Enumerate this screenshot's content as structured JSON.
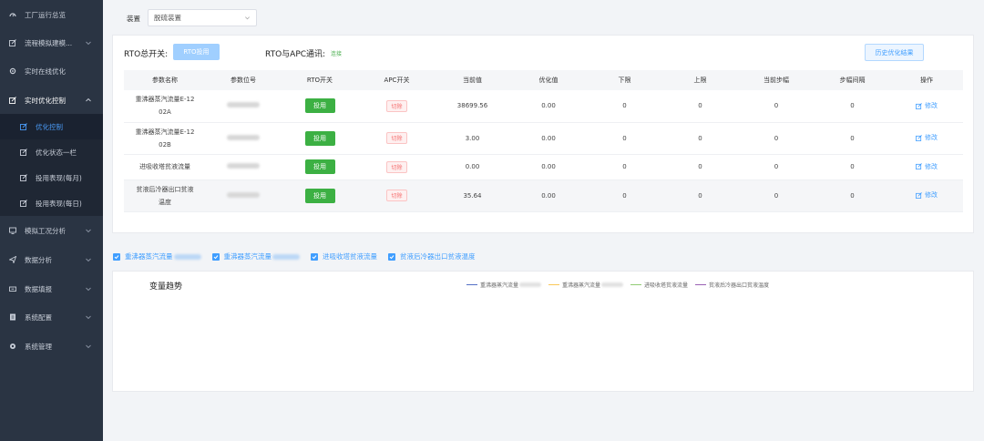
{
  "sidebar": {
    "items": [
      {
        "label": "工厂运行总览",
        "icon": "dashboard-icon"
      },
      {
        "label": "流程模拟建模...",
        "icon": "edit-icon"
      },
      {
        "label": "实时在线优化",
        "icon": "gear-icon"
      },
      {
        "label": "实时优化控制",
        "icon": "edit-icon"
      },
      {
        "label": "模拟工况分析",
        "icon": "monitor-icon"
      },
      {
        "label": "数据分析",
        "icon": "send-icon"
      },
      {
        "label": "数据填报",
        "icon": "inbox-icon"
      },
      {
        "label": "系统配置",
        "icon": "doc-icon"
      },
      {
        "label": "系统管理",
        "icon": "gear-icon"
      }
    ],
    "sub_items": [
      {
        "label": "优化控制"
      },
      {
        "label": "优化状态一栏"
      },
      {
        "label": "投用表现(每月)"
      },
      {
        "label": "投用表现(每日)"
      }
    ]
  },
  "filter": {
    "device_label": "装置",
    "device_value": "脱硫装置"
  },
  "control": {
    "rto_label": "RTO总开关:",
    "rto_button": "RTO投用",
    "apc_label": "RTO与APC通讯:",
    "apc_status": "连接",
    "history_button": "历史优化结果"
  },
  "table": {
    "headers": [
      "参数名称",
      "参数位号",
      "RTO开关",
      "APC开关",
      "当前值",
      "优化值",
      "下限",
      "上限",
      "当前步幅",
      "步幅间隔",
      "操作"
    ],
    "rows": [
      {
        "name_line1": "重沸器蒸汽流量E-12",
        "name_line2": "02A",
        "rto": "投用",
        "apc": "切除",
        "current": "38699.56",
        "optimized": "0.00",
        "low": "0",
        "high": "0",
        "step": "0",
        "interval": "0",
        "action": "修改"
      },
      {
        "name_line1": "重沸器蒸汽流量E-12",
        "name_line2": "02B",
        "rto": "投用",
        "apc": "切除",
        "current": "3.00",
        "optimized": "0.00",
        "low": "0",
        "high": "0",
        "step": "0",
        "interval": "0",
        "action": "修改"
      },
      {
        "name_line1": "进吸收塔贫液流量",
        "name_line2": "",
        "rto": "投用",
        "apc": "切除",
        "current": "0.00",
        "optimized": "0.00",
        "low": "0",
        "high": "0",
        "step": "0",
        "interval": "0",
        "action": "修改"
      },
      {
        "name_line1": "贫液后冷器出口贫液",
        "name_line2": "温度",
        "rto": "投用",
        "apc": "切除",
        "current": "35.64",
        "optimized": "0.00",
        "low": "0",
        "high": "0",
        "step": "0",
        "interval": "0",
        "action": "修改"
      }
    ]
  },
  "checks": [
    {
      "label": "重沸器蒸汽流量",
      "blur": true
    },
    {
      "label": "重沸器蒸汽流量",
      "blur": true
    },
    {
      "label": "进吸收塔贫液流量",
      "blur": false
    },
    {
      "label": "贫液后冷器出口贫液温度",
      "blur": false
    }
  ],
  "trend": {
    "title": "变量趋势",
    "legend": [
      {
        "label": "重沸器蒸汽流量",
        "color": "#5470c6",
        "blur": true
      },
      {
        "label": "重沸器蒸汽流量",
        "color": "#fac858",
        "blur": true
      },
      {
        "label": "进吸收塔贫液流量",
        "color": "#91cc75",
        "blur": false
      },
      {
        "label": "贫液后冷器出口贫液温度",
        "color": "#9a60b4",
        "blur": false
      }
    ]
  },
  "colors": {
    "sidebar_bg": "#2a3443",
    "accent": "#409eff",
    "green": "#3cb043",
    "danger": "#f56c6c"
  }
}
